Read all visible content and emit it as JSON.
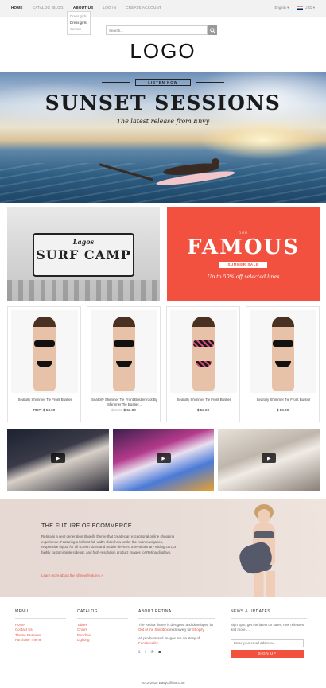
{
  "topbar": {
    "nav": [
      "HOME",
      "CATALOG",
      "BLOG",
      "ABOUT US",
      "LOG IN",
      "CREATE ACCOUNT"
    ],
    "dropdown": [
      "Dress girls",
      "Dress girls",
      "Sunset"
    ],
    "language": "English",
    "currency": "USD"
  },
  "search": {
    "placeholder": "Search..."
  },
  "logo": "LOGO",
  "hero": {
    "tag": "LISTEN NOW",
    "title": "SUNSET SESSIONS",
    "subtitle": "The latest release from Envy"
  },
  "promo_left": {
    "small": "Lagos",
    "big": "SURF CAMP"
  },
  "promo_right": {
    "small": "OUR",
    "big": "FAMOUS",
    "ribbon": "SUMMER SALE",
    "tagline": "Up to 50% off selected lines"
  },
  "products": [
    {
      "title": "Seafolly Shimmer Tie Front Bustier",
      "price_label": "RRP:",
      "price": "$ 53.00",
      "old_price": ""
    },
    {
      "title": "Seafolly Shimmer Tie Front Bustier root By Shimmer Tie Bustier...",
      "price_label": "",
      "price": "$ 53.00",
      "old_price": "$55.00"
    },
    {
      "title": "Seafolly Shimmer Tie Front Bustier",
      "price_label": "",
      "price": "$ 53.00",
      "old_price": ""
    },
    {
      "title": "Seafolly Shimmer Tie Front Bustier",
      "price_label": "",
      "price": "$ 53.00",
      "old_price": ""
    }
  ],
  "feature": {
    "title": "THE FUTURE OF ECOMMERCE",
    "body": "Retina is a next generation Shopify theme that creates an exceptional online shopping experience. Featuring a brilliant full-width slideshow under the main navigation, responsive layout for all screen sizes and mobile devices, a revolutionary sliding cart, a highly customizable sidebar, and high-resolution product images for Retina displays.",
    "link": "Learn more about the all new features »"
  },
  "footer": {
    "menu": {
      "head": "MENU",
      "items": [
        "Home",
        "Contact Us",
        "Theme Features",
        "Purchase Theme"
      ]
    },
    "catalog": {
      "head": "CATALOG",
      "items": [
        "Tables",
        "Chairs",
        "Benches",
        "Lighting"
      ]
    },
    "about": {
      "head": "ABOUT RETINA",
      "text1": "The Retina theme is designed and developed by",
      "link1": "Out of the Sandbox",
      "text2": "exclusively for",
      "link2": "Shopify",
      "text3": "All products and images are courtesy of",
      "link3": "Functionality."
    },
    "news": {
      "head": "NEWS & UPDATES",
      "text": "Sign up to get the latest on sales, new releases and more …",
      "placeholder": "Enter your email address...",
      "button": "SIGN UP"
    }
  },
  "copyright": "2012-2015 EasyOfficial.com"
}
